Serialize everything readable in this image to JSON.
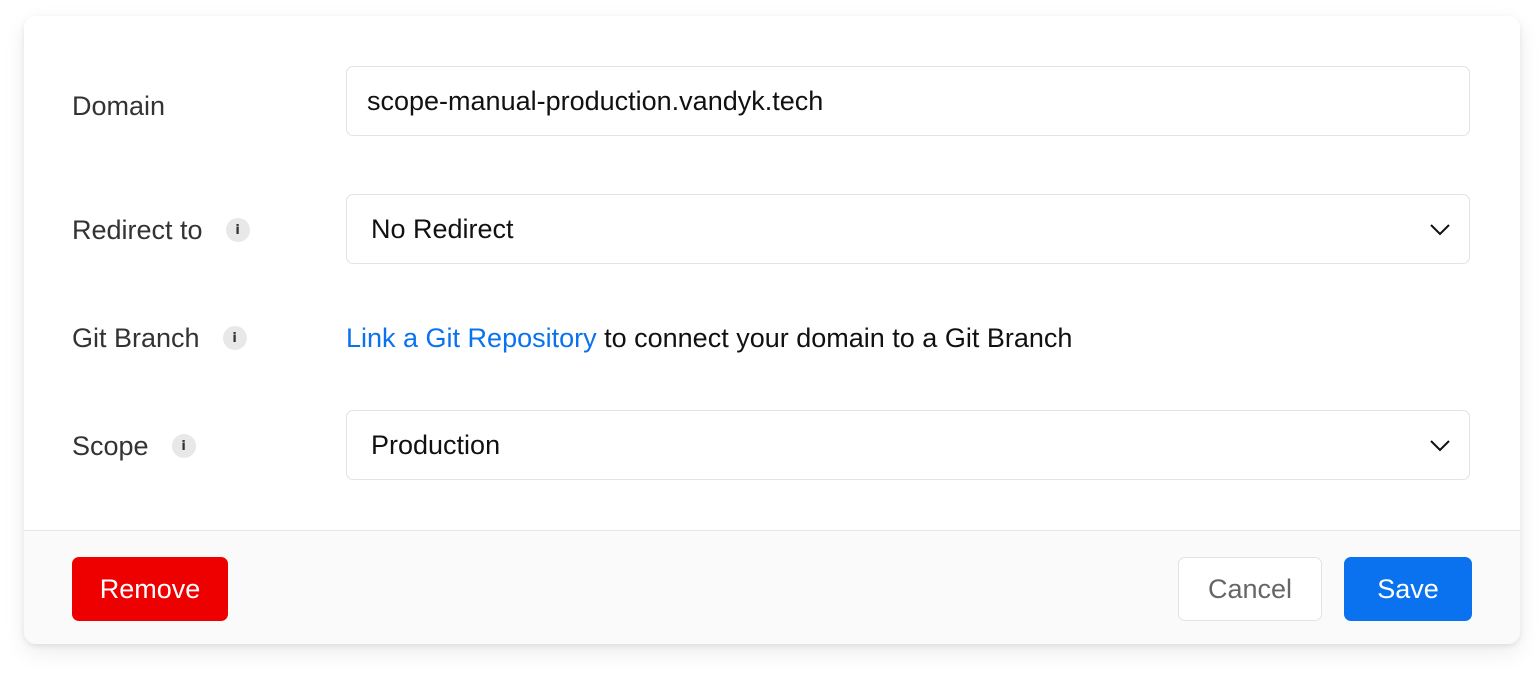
{
  "form": {
    "domain": {
      "label": "Domain",
      "value": "scope-manual-production.vandyk.tech"
    },
    "redirect": {
      "label": "Redirect to",
      "info_icon": "info-icon",
      "selected": "No Redirect"
    },
    "git_branch": {
      "label": "Git Branch",
      "info_icon": "info-icon",
      "link_text": "Link a Git Repository",
      "suffix_text": " to connect your domain to a Git Branch"
    },
    "scope": {
      "label": "Scope",
      "info_icon": "info-icon",
      "selected": "Production"
    }
  },
  "footer": {
    "remove_label": "Remove",
    "cancel_label": "Cancel",
    "save_label": "Save"
  },
  "colors": {
    "accent": "#0a72ef",
    "danger": "#ee0000",
    "label_text": "#333333",
    "border": "#e3e3e3",
    "footer_bg": "#fafafa"
  },
  "icons": {
    "info": "i",
    "chevron": "chevron-down-icon"
  }
}
